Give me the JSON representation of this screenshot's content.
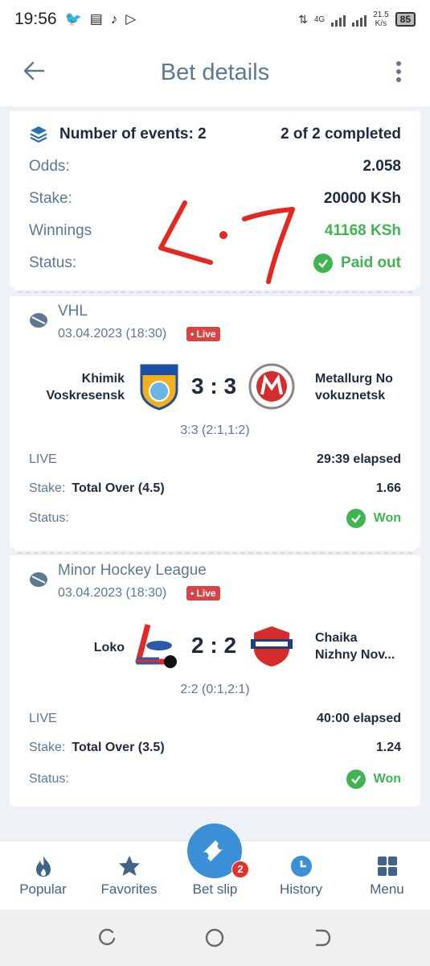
{
  "status_bar": {
    "time": "19:56",
    "network": "4G",
    "speed_value": "21.5",
    "speed_unit": "K/s",
    "battery": "85"
  },
  "header": {
    "title": "Bet details"
  },
  "summary": {
    "events_label": "Number of events: 2",
    "completed": "2 of 2 completed",
    "odds_label": "Odds:",
    "odds_value": "2.058",
    "stake_label": "Stake:",
    "stake_value": "20000 KSh",
    "winnings_label": "Winnings",
    "winnings_value": "41168 KSh",
    "status_label": "Status:",
    "status_value": "Paid out",
    "handwritten_annotation": "K·7"
  },
  "events": [
    {
      "league": "VHL",
      "date": "03.04.2023 (18:30)",
      "live_badge": "• Live",
      "home_line1": "Khimik",
      "home_line2": "Voskresensk",
      "score": "3 : 3",
      "away_line1": "Metallurg No",
      "away_line2": "vokuznetsk",
      "subscore": "3:3 (2:1,1:2)",
      "period": "LIVE",
      "elapsed": "29:39 elapsed",
      "stake_label": "Stake:",
      "market": "Total Over (4.5)",
      "odds": "1.66",
      "status_label": "Status:",
      "status": "Won"
    },
    {
      "league": "Minor Hockey League",
      "date": "03.04.2023 (18:30)",
      "live_badge": "• Live",
      "home_line1": "Loko",
      "home_line2": "",
      "score": "2 : 2",
      "away_line1": "Chaika",
      "away_line2": "Nizhny Nov...",
      "subscore": "2:2 (0:1,2:1)",
      "period": "LIVE",
      "elapsed": "40:00 elapsed",
      "stake_label": "Stake:",
      "market": "Total Over (3.5)",
      "odds": "1.24",
      "status_label": "Status:",
      "status": "Won"
    }
  ],
  "bottom_nav": {
    "popular": "Popular",
    "favorites": "Favorites",
    "bet_slip": "Bet slip",
    "bet_slip_count": "2",
    "history": "History",
    "menu": "Menu"
  },
  "colors": {
    "accent": "#3b8fd6",
    "title": "#5b7894",
    "success": "#3fb552",
    "live": "#d64545",
    "annotation": "#e5271f"
  }
}
